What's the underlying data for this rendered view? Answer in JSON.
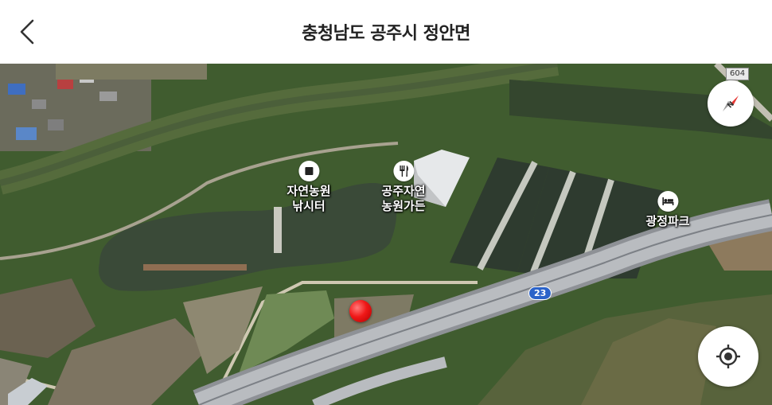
{
  "header": {
    "title": "충청남도 공주시 정안면",
    "back_icon": "chevron-left-icon"
  },
  "map": {
    "type": "satellite",
    "pois": [
      {
        "label": "자연농원\n낚시터",
        "icon": "square-stop-icon"
      },
      {
        "label": "공주자연\n농원가든",
        "icon": "fork-knife-icon"
      },
      {
        "label": "광정파크",
        "icon": "bed-icon"
      }
    ],
    "road_badges": {
      "national": "23",
      "local": "604"
    },
    "marker": {
      "icon": "red-pin-icon",
      "color": "#f01818"
    }
  },
  "controls": {
    "compass_icon": "compass-icon",
    "locate_icon": "crosshair-icon"
  },
  "colors": {
    "road_badge": "#2b63c9",
    "marker": "#f01818"
  }
}
